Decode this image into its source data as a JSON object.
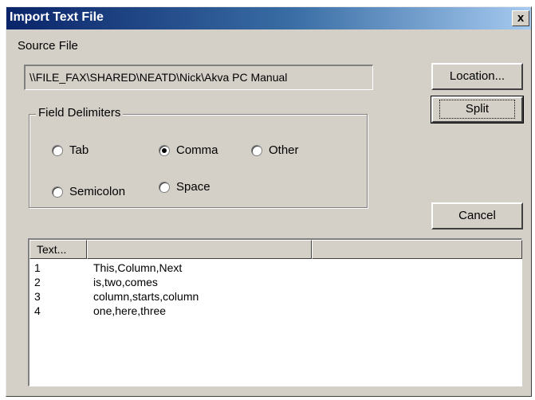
{
  "dialog": {
    "title": "Import Text File",
    "close_label": "x"
  },
  "source": {
    "label": "Source File",
    "value": "\\\\FILE_FAX\\SHARED\\NEATD\\Nick\\Akva PC Manual"
  },
  "buttons": {
    "location": "Location...",
    "split": "Split",
    "cancel": "Cancel"
  },
  "delimiters": {
    "title": "Field Delimiters",
    "options": [
      {
        "label": "Tab",
        "checked": false
      },
      {
        "label": "Comma",
        "checked": true
      },
      {
        "label": "Other",
        "checked": false
      },
      {
        "label": "Semicolon",
        "checked": false
      },
      {
        "label": "Space",
        "checked": false
      }
    ]
  },
  "list": {
    "columns": [
      "Text...",
      "",
      ""
    ],
    "rows": [
      {
        "num": "1",
        "text": "This,Column,Next"
      },
      {
        "num": "2",
        "text": "is,two,comes"
      },
      {
        "num": "3",
        "text": "column,starts,column"
      },
      {
        "num": "4",
        "text": "one,here,three"
      }
    ]
  }
}
